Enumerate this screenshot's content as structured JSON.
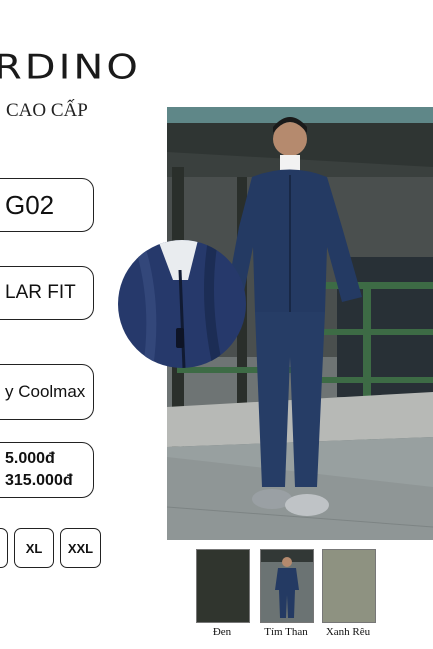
{
  "brand": {
    "logo": "RDINO",
    "tagline": "CAO CẤP"
  },
  "product": {
    "code": "G02",
    "fit": "LAR FIT",
    "fabric": "y Coolmax",
    "price_line1": "5.000đ",
    "price_line2": "315.000đ"
  },
  "sizes": [
    "XL",
    "XXL"
  ],
  "colors": [
    {
      "label": "Đen",
      "hex": "#30352e"
    },
    {
      "label": "Tím Than",
      "hex": "#2b3a5e"
    },
    {
      "label": "Xanh Rêu",
      "hex": "#8e9281"
    }
  ],
  "icons": {
    "zipper_detail": "zoom-circle-icon"
  }
}
